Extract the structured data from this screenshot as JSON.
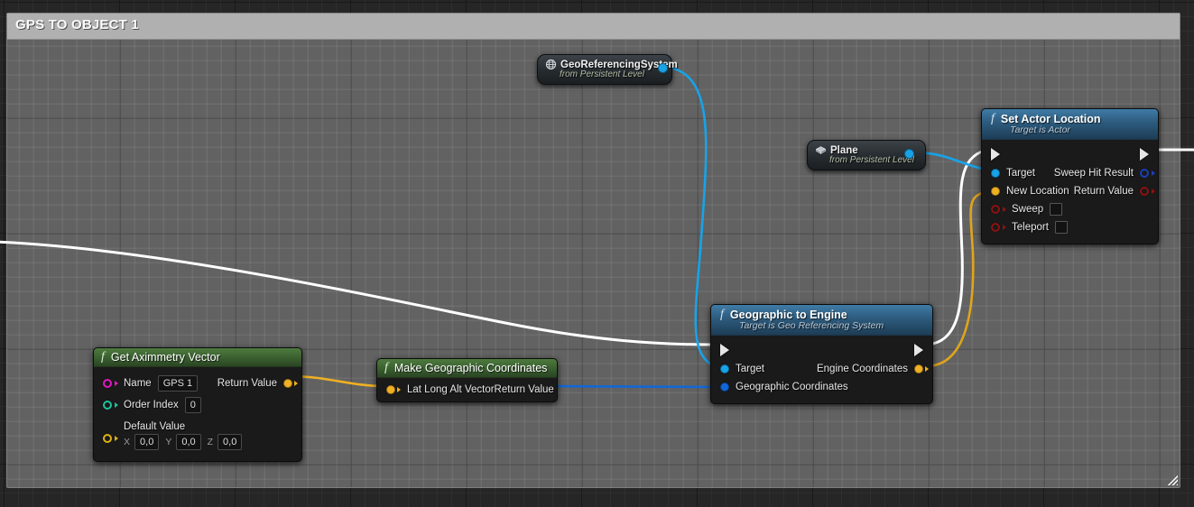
{
  "comment": {
    "title": "GPS TO OBJECT 1",
    "resize_grip": "resize-grip"
  },
  "nodes": {
    "geo_ref_system": {
      "title": "GeoReferencingSystem",
      "subtitle": "from Persistent Level",
      "icon": "globe-icon",
      "output_pin": "object-reference-out"
    },
    "plane": {
      "title": "Plane",
      "subtitle": "from Persistent Level",
      "icon": "mesh-icon",
      "output_pin": "object-reference-out"
    },
    "get_aximmetry_vector": {
      "title": "Get Aximmetry Vector",
      "fn_glyph": "f",
      "inputs": [
        {
          "label": "Name",
          "value": "GPS 1",
          "pin_color": "#e219c0",
          "pin_style": "hollow"
        },
        {
          "label": "Order Index",
          "value": "0",
          "pin_color": "#1fc39b",
          "pin_style": "hollow"
        }
      ],
      "default_value": {
        "label": "Default Value",
        "pin_color": "#ddb215",
        "pin_style": "hollow",
        "axes": [
          {
            "axis": "X",
            "value": "0,0"
          },
          {
            "axis": "Y",
            "value": "0,0"
          },
          {
            "axis": "Z",
            "value": "0,0"
          }
        ]
      },
      "outputs": [
        {
          "label": "Return Value",
          "pin_color": "#f0b024",
          "pin_style": "filled"
        }
      ]
    },
    "make_geographic_coordinates": {
      "title": "Make Geographic Coordinates",
      "fn_glyph": "f",
      "inputs": [
        {
          "label": "Lat Long Alt Vector",
          "pin_color": "#f0b024",
          "pin_style": "filled"
        }
      ],
      "outputs": [
        {
          "label": "Return Value",
          "pin_color": "#1267d6",
          "pin_style": "filled"
        }
      ]
    },
    "geographic_to_engine": {
      "title": "Geographic to Engine",
      "subtitle": "Target is Geo Referencing System",
      "fn_glyph": "f",
      "exec_in": "exec-in",
      "exec_out": "exec-out",
      "inputs": [
        {
          "label": "Target",
          "pin_color": "#18a3e8",
          "pin_style": "filled"
        },
        {
          "label": "Geographic Coordinates",
          "pin_color": "#1267d6",
          "pin_style": "filled"
        }
      ],
      "outputs": [
        {
          "label": "Engine Coordinates",
          "pin_color": "#f0b024",
          "pin_style": "filled"
        }
      ]
    },
    "set_actor_location": {
      "title": "Set Actor Location",
      "subtitle": "Target is Actor",
      "fn_glyph": "f",
      "exec_in": "exec-in",
      "exec_out": "exec-out",
      "inputs": [
        {
          "label": "Target",
          "pin_color": "#18a3e8",
          "pin_style": "filled",
          "control": "none"
        },
        {
          "label": "New Location",
          "pin_color": "#f0b024",
          "pin_style": "filled",
          "control": "none"
        },
        {
          "label": "Sweep",
          "pin_color": "#8c1212",
          "pin_style": "hollow",
          "control": "checkbox"
        },
        {
          "label": "Teleport",
          "pin_color": "#8c1212",
          "pin_style": "hollow",
          "control": "checkbox"
        }
      ],
      "outputs": [
        {
          "label": "Sweep Hit Result",
          "pin_color": "#1b3fb8",
          "pin_style": "hollow"
        },
        {
          "label": "Return Value",
          "pin_color": "#8c1212",
          "pin_style": "hollow"
        }
      ]
    }
  },
  "wires": [
    {
      "name": "exec-in-to-geographic-to-engine",
      "color": "#ffffff"
    },
    {
      "name": "georef-to-geographic-to-engine-target",
      "color": "#18a3e8"
    },
    {
      "name": "aximmetry-returnvalue-to-latlongalt",
      "color": "#f0b024"
    },
    {
      "name": "make-geo-returnvalue-to-geographic-coordinates",
      "color": "#1267d6"
    },
    {
      "name": "geographic-to-engine-exec-to-set-actor-location-exec",
      "color": "#ffffff"
    },
    {
      "name": "engine-coordinates-to-new-location",
      "color": "#dfa41c"
    },
    {
      "name": "plane-to-set-actor-location-target",
      "color": "#18a3e8"
    },
    {
      "name": "set-actor-location-exec-out",
      "color": "#ffffff"
    }
  ],
  "colors": {
    "exec_white": "#ffffff",
    "object_blue": "#18a3e8",
    "struct_blue": "#1267d6",
    "vector_yellow": "#f0b024",
    "bool_red": "#8c1212",
    "name_magenta": "#e219c0",
    "int_teal": "#1fc39b",
    "comment_fill": "#bebebe"
  }
}
